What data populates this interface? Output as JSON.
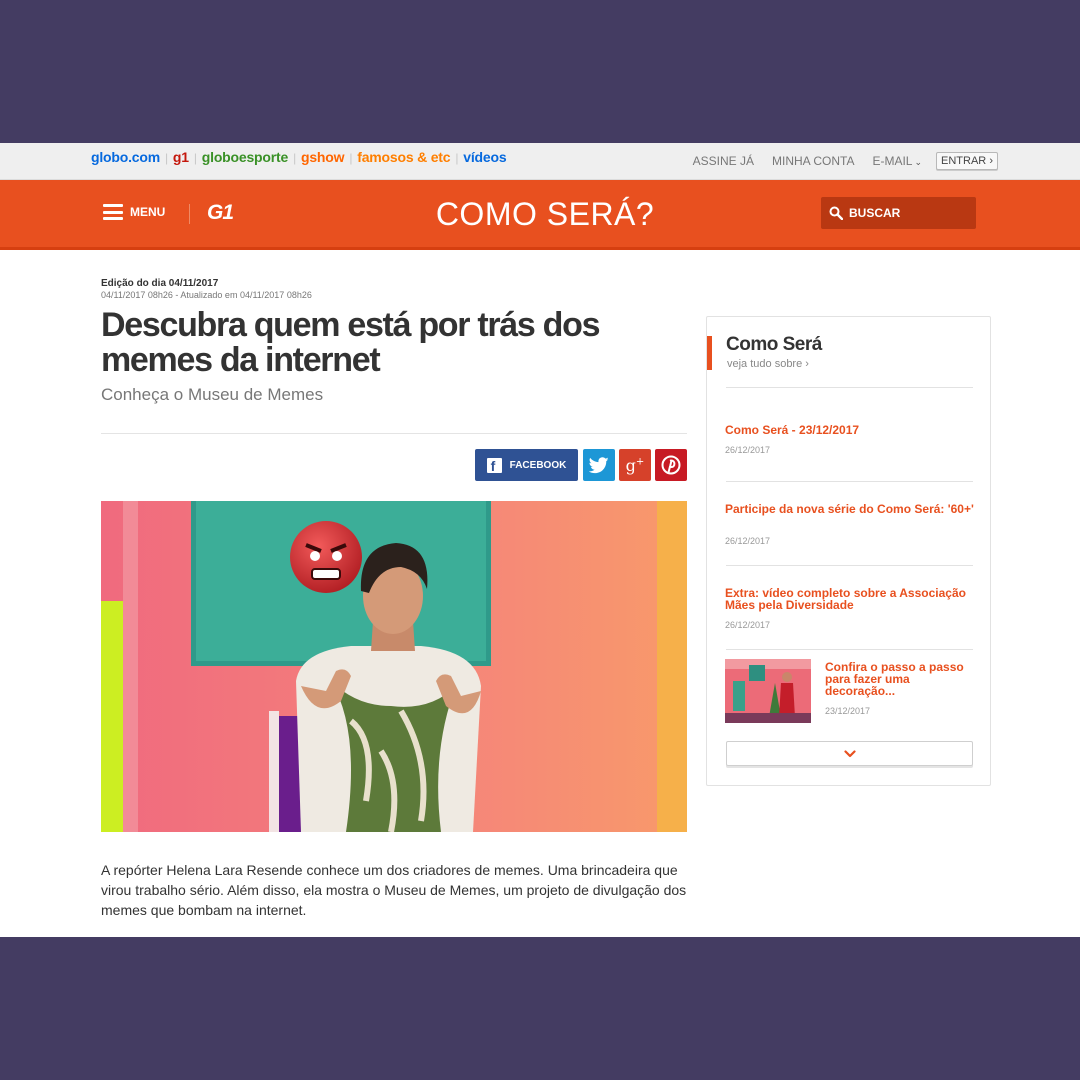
{
  "topbar": {
    "links": [
      "globo.com",
      "g1",
      "globoesporte",
      "gshow",
      "famosos & etc",
      "vídeos"
    ],
    "right": {
      "assine": "ASSINE JÁ",
      "minha_conta": "MINHA CONTA",
      "email": "E-MAIL",
      "entrar": "ENTRAR"
    }
  },
  "header": {
    "menu_label": "MENU",
    "logo": "G1",
    "section_title": "COMO SERÁ?",
    "search_label": "BUSCAR",
    "accent_color": "#e8501f"
  },
  "article": {
    "edition": "Edição do dia 04/11/2017",
    "timestamp": "04/11/2017 08h26 - Atualizado em 04/11/2017 08h26",
    "headline": "Descubra quem está por trás dos memes da internet",
    "subtitle": "Conheça o Museu de Memes",
    "share": {
      "facebook": "FACEBOOK",
      "twitter_icon": "twitter-icon",
      "gplus_icon": "google-plus-icon",
      "pinterest_icon": "pinterest-icon"
    },
    "body": "A repórter Helena Lara Resende conhece um dos criadores de memes. Uma brincadeira que virou trabalho sério. Além disso, ela mostra o Museu de Memes, um projeto de divulgação dos memes que bombam na internet."
  },
  "sidebar": {
    "title": "Como Será",
    "see_all": "veja tudo sobre ›",
    "items": [
      {
        "title": "Como Será - 23/12/2017",
        "date": "26/12/2017"
      },
      {
        "title": "Participe da nova série do Como Será: '60+'",
        "date": "26/12/2017"
      },
      {
        "title": "Extra: vídeo completo sobre a Associação Mães pela Diversidade",
        "date": "26/12/2017"
      },
      {
        "title": "Confira o passo a passo para fazer uma decoração...",
        "date": "23/12/2017"
      }
    ],
    "more_icon": "chevron-down-icon"
  }
}
